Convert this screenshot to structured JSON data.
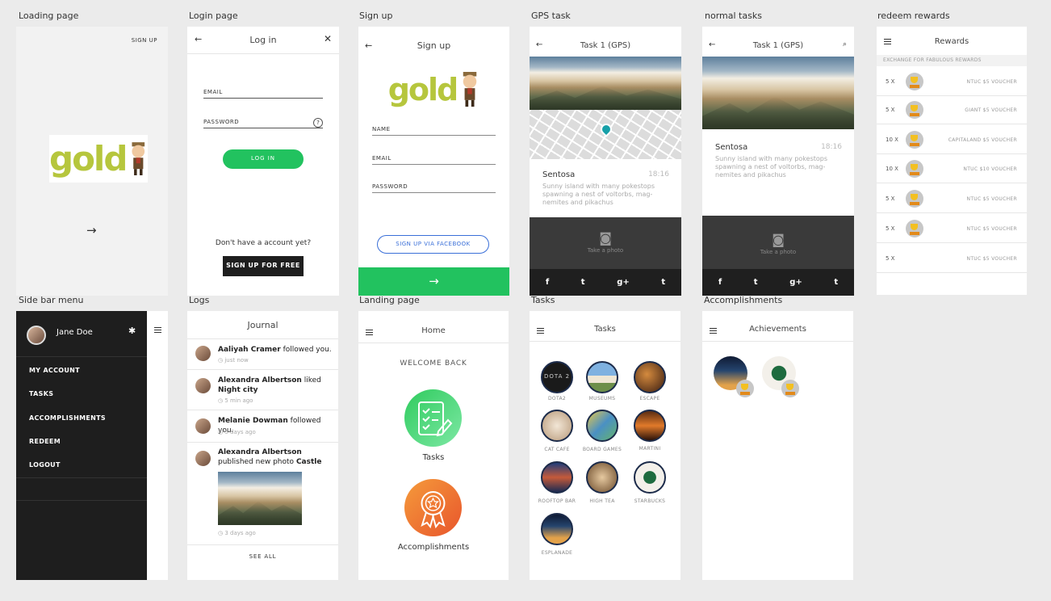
{
  "labels": {
    "loading": "Loading page",
    "login": "Login page",
    "signup": "Sign up",
    "gps": "GPS task",
    "normal": "normal tasks",
    "redeem": "redeem rewards",
    "sidebar": "Side bar menu",
    "logs": "Logs",
    "landing": "Landing page",
    "tasks": "Tasks",
    "accomplishments": "Accomplishments"
  },
  "loading": {
    "signup_link": "SIGN UP",
    "logo_word": "gold",
    "next_icon": "arrow-right-icon"
  },
  "login": {
    "title": "Log in",
    "email_label": "EMAIL",
    "password_label": "PASSWORD",
    "help_glyph": "?",
    "login_button": "LOG IN",
    "no_account_text": "Don't have a account yet?",
    "signup_button": "SIGN UP FOR FREE"
  },
  "signup": {
    "title": "Sign up",
    "logo_word": "gold",
    "name_label": "NAME",
    "email_label": "EMAIL",
    "password_label": "PASSWORD",
    "facebook_button": "SIGN UP VIA FACEBOOK"
  },
  "gps_task": {
    "title": "Task 1 (GPS)",
    "place": "Sentosa",
    "time": "18:16",
    "description": "Sunny island with many pokestops spawning a nest of voltorbs, mag-nemites and pikachus",
    "photo_label": "Take a photo",
    "social": [
      "f",
      "t",
      "g+",
      "t"
    ]
  },
  "normal_task": {
    "title": "Task 1 (GPS)",
    "place": "Sentosa",
    "time": "18:16",
    "description": "Sunny island with many pokestops spawning a nest of voltorbs, mag-nemites and pikachus",
    "photo_label": "Take a photo",
    "social": [
      "f",
      "t",
      "g+",
      "t"
    ]
  },
  "rewards": {
    "title": "Rewards",
    "subheader": "EXCHANGE FOR FABULOUS REWARDS",
    "items": [
      {
        "qty": "5 X",
        "name": "NTUC $5 VOUCHER"
      },
      {
        "qty": "5 X",
        "name": "GIANT $5 VOUCHER"
      },
      {
        "qty": "10 X",
        "name": "CAPITALAND $5 VOUCHER"
      },
      {
        "qty": "10 X",
        "name": "NTUC $10 VOUCHER"
      },
      {
        "qty": "5 X",
        "name": "NTUC $5 VOUCHER"
      },
      {
        "qty": "5 X",
        "name": "NTUC $5 VOUCHER"
      },
      {
        "qty": "5 X",
        "name": "NTUC $5 VOUCHER"
      }
    ]
  },
  "sidebar": {
    "user_name": "Jane Doe",
    "items": [
      "MY ACCOUNT",
      "TASKS",
      "ACCOMPLISHMENTS",
      "REDEEM",
      "LOGOUT"
    ]
  },
  "journal": {
    "title": "Journal",
    "entries": [
      {
        "name": "Aaliyah Cramer",
        "action": "followed you.",
        "extra": "",
        "ago": "just now"
      },
      {
        "name": "Alexandra Albertson",
        "action": "liked",
        "extra": "Night city",
        "ago": "5 min ago"
      },
      {
        "name": "Melanie Dowman",
        "action": "followed you.",
        "extra": "",
        "ago": "5 days ago"
      },
      {
        "name": "Alexandra Albertson",
        "action": "published new photo",
        "extra": "Castle",
        "ago": "3 days ago"
      }
    ],
    "see_all": "SEE ALL"
  },
  "home": {
    "title": "Home",
    "welcome": "WELCOME BACK",
    "tasks_label": "Tasks",
    "accomplishments_label": "Accomplishments"
  },
  "tasks_screen": {
    "title": "Tasks",
    "items": [
      "DOTA2",
      "MUSEUMS",
      "ESCAPE",
      "CAT CAFE",
      "BOARD GAMES",
      "MARTINI",
      "ROOFTOP BAR",
      "HIGH TEA",
      "STARBUCKS",
      "ESPLANADE"
    ],
    "dota_text": "DOTA 2"
  },
  "achievements": {
    "title": "Achievements"
  },
  "colors": {
    "green": "#22c25f",
    "dark": "#1e1e1e",
    "logo": "#b6c63d",
    "facebook_blue": "#3a6fd8"
  }
}
